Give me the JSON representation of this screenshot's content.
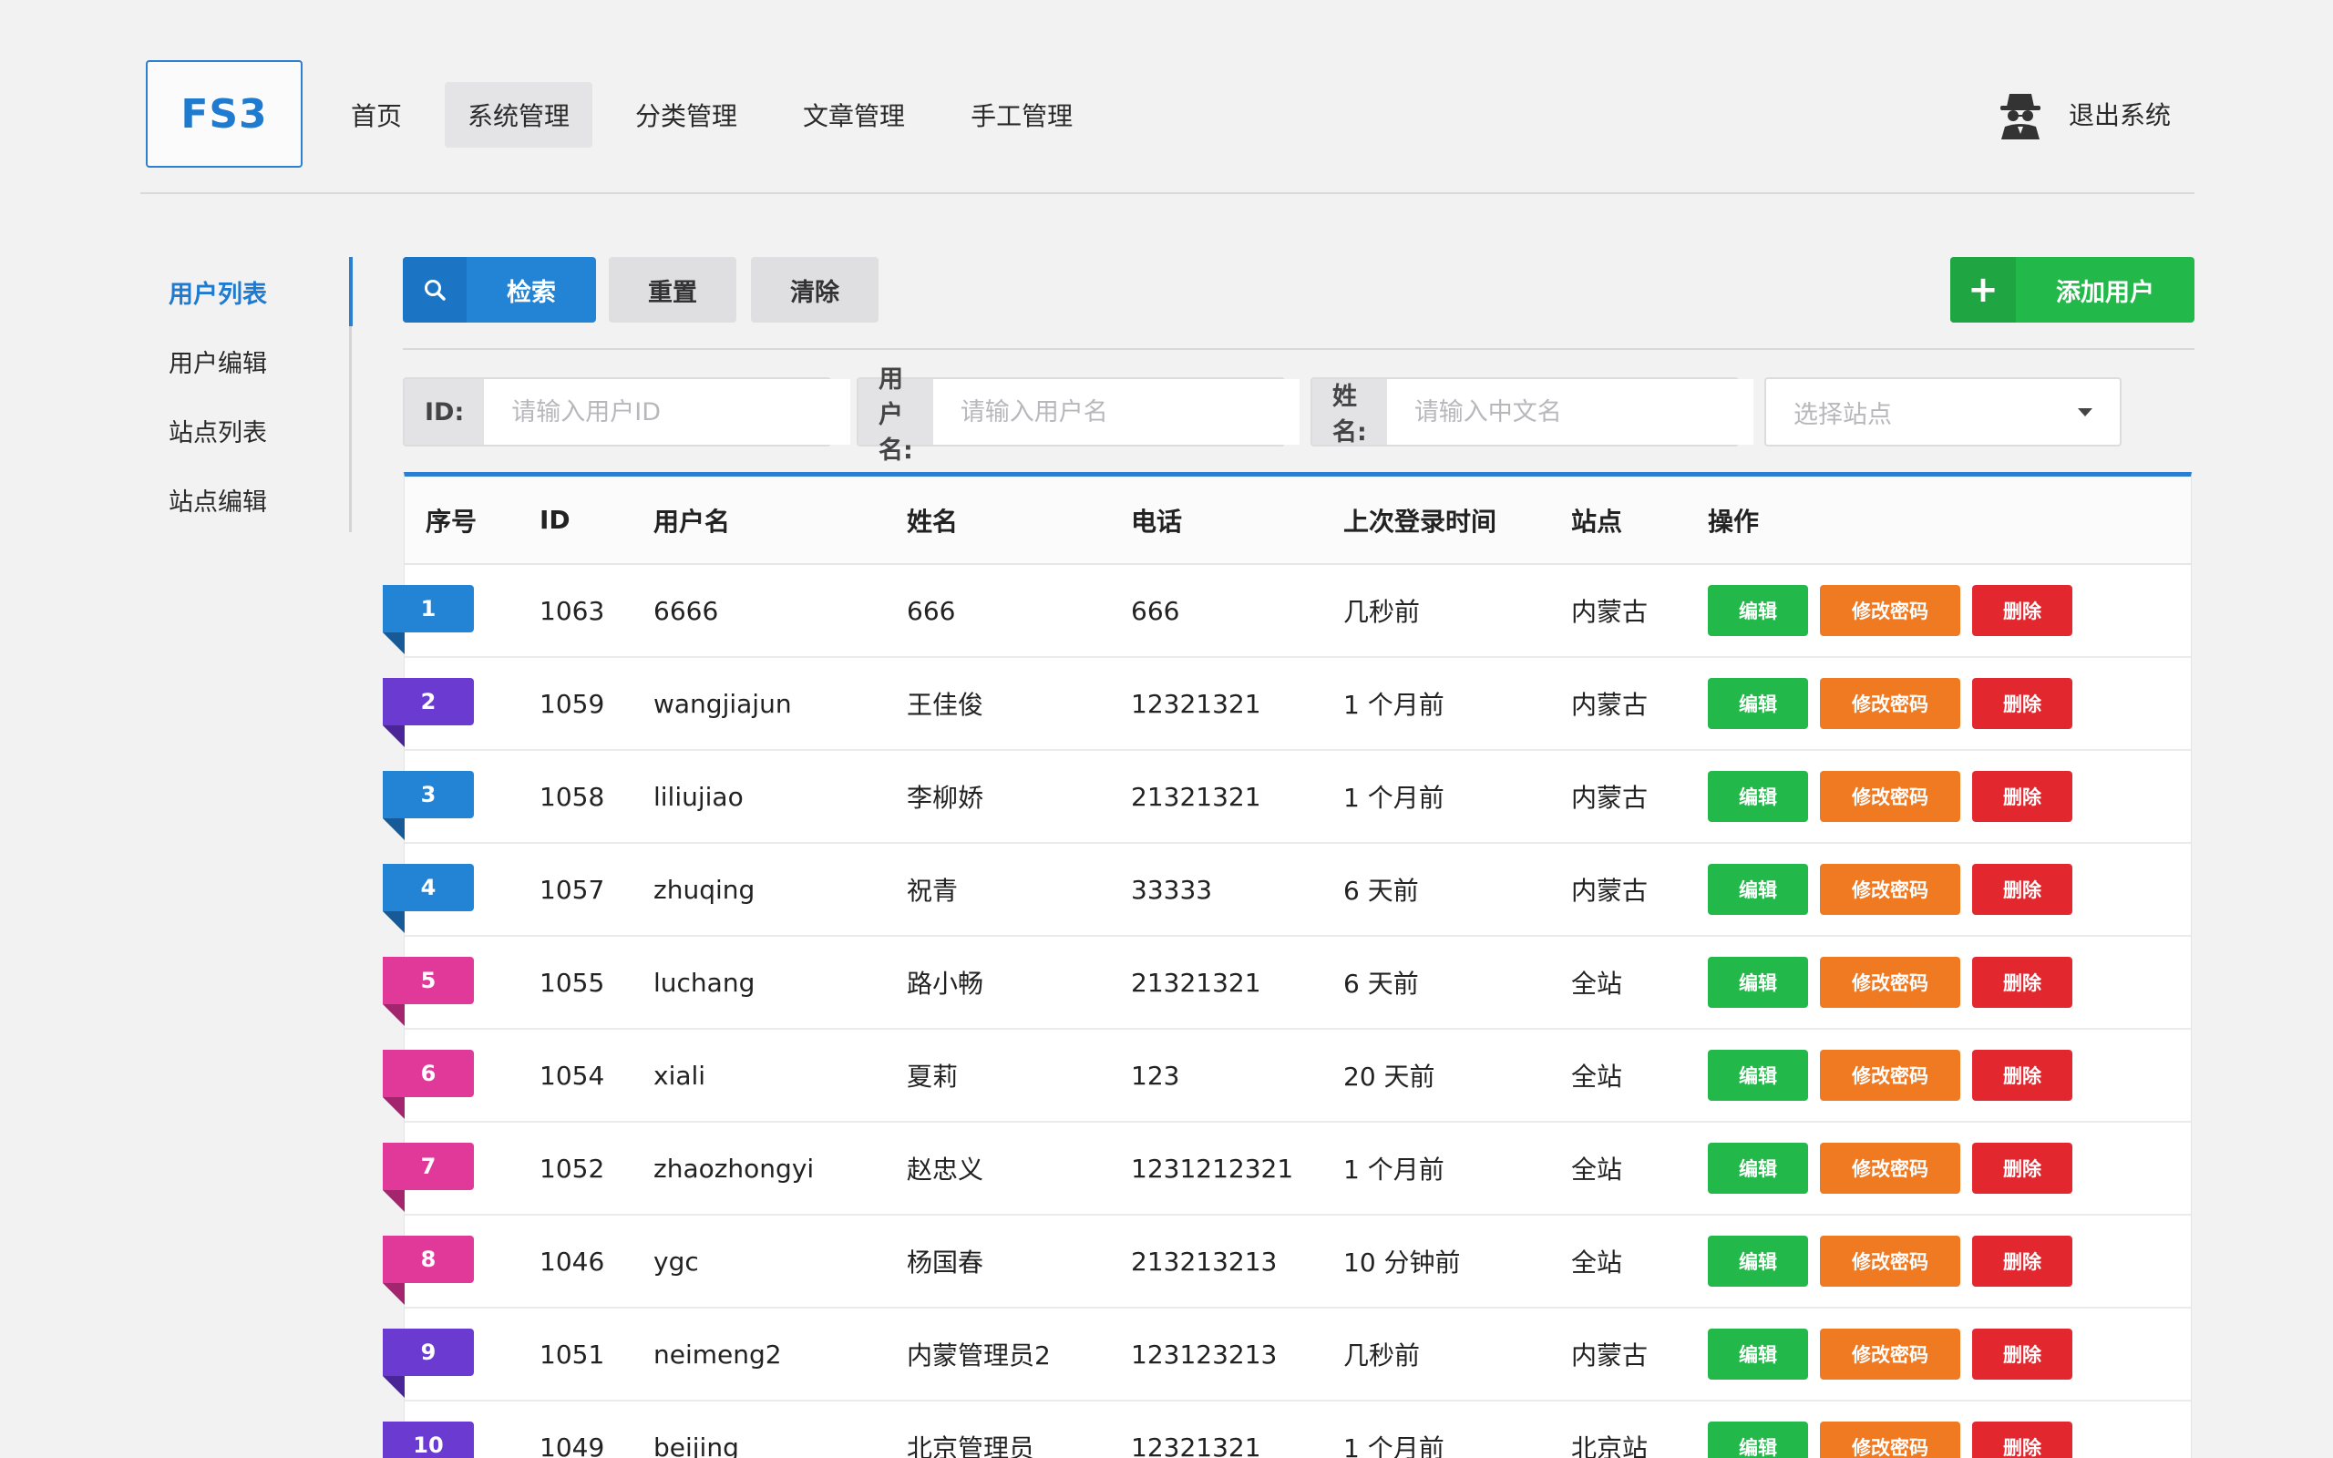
{
  "header": {
    "logo": "FS3",
    "nav": [
      {
        "label": "首页",
        "active": false
      },
      {
        "label": "系统管理",
        "active": true
      },
      {
        "label": "分类管理",
        "active": false
      },
      {
        "label": "文章管理",
        "active": false
      },
      {
        "label": "手工管理",
        "active": false
      }
    ],
    "logout_label": "退出系统",
    "user_icon": "spy-icon"
  },
  "sidebar": {
    "items": [
      {
        "label": "用户列表",
        "active": true
      },
      {
        "label": "用户编辑",
        "active": false
      },
      {
        "label": "站点列表",
        "active": false
      },
      {
        "label": "站点编辑",
        "active": false
      }
    ]
  },
  "toolbar": {
    "search_label": "检索",
    "search_icon": "search-icon",
    "reset_label": "重置",
    "clear_label": "清除",
    "add_label": "添加用户",
    "add_icon": "plus-icon"
  },
  "filters": {
    "id_label": "ID:",
    "id_placeholder": "请输入用户ID",
    "username_label": "用户名:",
    "username_placeholder": "请输入用户名",
    "name_label": "姓名:",
    "name_placeholder": "请输入中文名",
    "site_placeholder": "选择站点"
  },
  "table": {
    "columns": [
      "序号",
      "ID",
      "用户名",
      "姓名",
      "电话",
      "上次登录时间",
      "站点",
      "操作"
    ],
    "actions": {
      "edit": "编辑",
      "password": "修改密码",
      "delete": "删除"
    },
    "rows": [
      {
        "idx": "1",
        "id": "1063",
        "username": "6666",
        "name": "666",
        "phone": "666",
        "last_login": "几秒前",
        "site": "内蒙古",
        "ribbon": "blue"
      },
      {
        "idx": "2",
        "id": "1059",
        "username": "wangjiajun",
        "name": "王佳俊",
        "phone": "12321321",
        "last_login": "1 个月前",
        "site": "内蒙古",
        "ribbon": "purple"
      },
      {
        "idx": "3",
        "id": "1058",
        "username": "liliujiao",
        "name": "李柳娇",
        "phone": "21321321",
        "last_login": "1 个月前",
        "site": "内蒙古",
        "ribbon": "blue"
      },
      {
        "idx": "4",
        "id": "1057",
        "username": "zhuqing",
        "name": "祝青",
        "phone": "33333",
        "last_login": "6 天前",
        "site": "内蒙古",
        "ribbon": "blue"
      },
      {
        "idx": "5",
        "id": "1055",
        "username": "luchang",
        "name": "路小畅",
        "phone": "21321321",
        "last_login": "6 天前",
        "site": "全站",
        "ribbon": "pink"
      },
      {
        "idx": "6",
        "id": "1054",
        "username": "xiali",
        "name": "夏莉",
        "phone": "123",
        "last_login": "20 天前",
        "site": "全站",
        "ribbon": "pink"
      },
      {
        "idx": "7",
        "id": "1052",
        "username": "zhaozhongyi",
        "name": "赵忠义",
        "phone": "1231212321",
        "last_login": "1 个月前",
        "site": "全站",
        "ribbon": "pink"
      },
      {
        "idx": "8",
        "id": "1046",
        "username": "ygc",
        "name": "杨国春",
        "phone": "213213213",
        "last_login": "10 分钟前",
        "site": "全站",
        "ribbon": "pink"
      },
      {
        "idx": "9",
        "id": "1051",
        "username": "neimeng2",
        "name": "内蒙管理员2",
        "phone": "123123213",
        "last_login": "几秒前",
        "site": "内蒙古",
        "ribbon": "purple"
      },
      {
        "idx": "10",
        "id": "1049",
        "username": "beijing",
        "name": "北京管理员",
        "phone": "12321321",
        "last_login": "1 个月前",
        "site": "北京站",
        "ribbon": "purple"
      }
    ]
  }
}
